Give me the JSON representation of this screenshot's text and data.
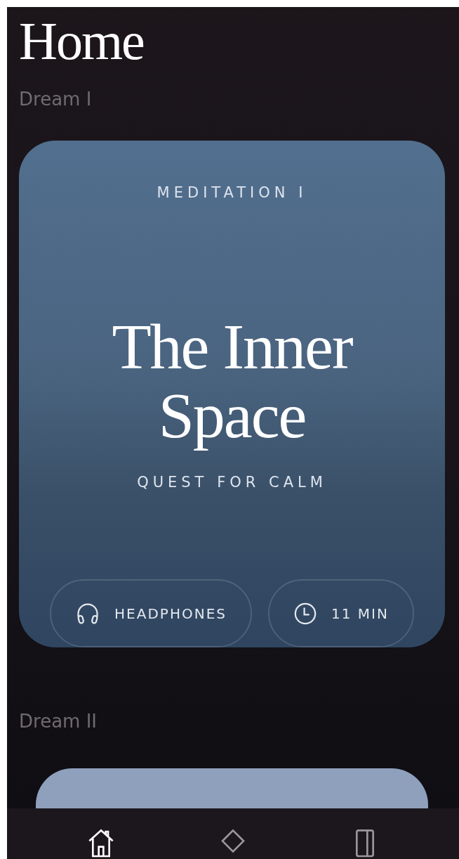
{
  "title": "Home",
  "sections": [
    {
      "heading": "Dream I",
      "card": {
        "kind": "full",
        "eyebrow": "MEDITATION I",
        "title": "The Inner Space",
        "subtitle": "QUEST FOR CALM",
        "chips": [
          {
            "kind": "headphones",
            "label": "HEADPHONES"
          },
          {
            "kind": "clock",
            "label": "11 MIN"
          }
        ]
      }
    },
    {
      "heading": "Dream II",
      "card": {
        "kind": "peek"
      }
    }
  ],
  "tabs": [
    {
      "kind": "home",
      "selected": true
    },
    {
      "kind": "diamond",
      "selected": false
    },
    {
      "kind": "book",
      "selected": false
    }
  ]
}
